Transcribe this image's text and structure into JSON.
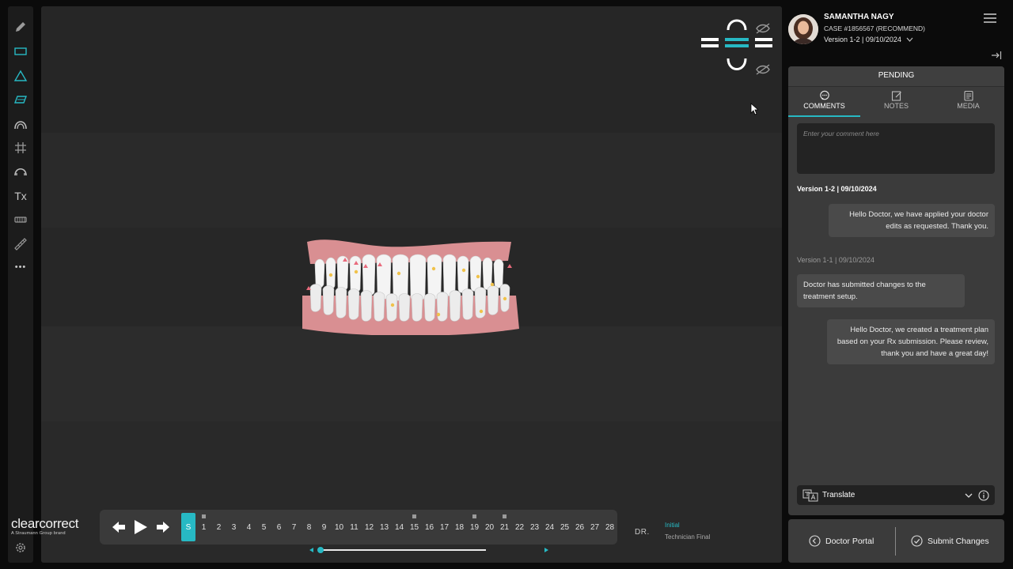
{
  "header": {
    "user_name": "SAMANTHA NAGY",
    "case_id": "CASE #1856567 (RECOMMEND)",
    "version_selected": "Version 1-2 | 09/10/2024"
  },
  "toolbar": {
    "tools": [
      "pencil-icon",
      "rectangle-icon",
      "triangle-icon",
      "parallelogram-icon",
      "arch-icon",
      "grid-icon",
      "upper-arch-icon",
      "tx-label",
      "teeth-icon",
      "ruler-icon",
      "more-icon"
    ],
    "tx_label": "Tx",
    "more_label": "•••"
  },
  "panel": {
    "status": "PENDING",
    "tabs": [
      {
        "label": "COMMENTS",
        "icon": "comment-icon",
        "active": true
      },
      {
        "label": "NOTES",
        "icon": "note-edit-icon",
        "active": false
      },
      {
        "label": "MEDIA",
        "icon": "media-icon",
        "active": false
      }
    ],
    "comment_placeholder": "Enter your comment here",
    "thread": [
      {
        "version": "Version 1-2 | 09/10/2024",
        "messages": [
          {
            "side": "right",
            "text": "Hello Doctor, we have applied your doctor edits as requested. Thank you."
          }
        ]
      },
      {
        "version": "Version 1-1 | 09/10/2024",
        "messages": [
          {
            "side": "left",
            "text": "Doctor has submitted changes to the treatment setup."
          },
          {
            "side": "right",
            "text": "Hello Doctor, we created a treatment plan based on your Rx submission. Please review, thank you and have a great day!"
          }
        ]
      }
    ],
    "translate_label": "Translate"
  },
  "actions": {
    "doctor_portal": "Doctor Portal",
    "submit_changes": "Submit Changes"
  },
  "viewer": {
    "logo_text": "clearcorrect",
    "logo_sub": "A Straumann Group brand",
    "stage_start_label": "S",
    "stages": [
      {
        "n": "1",
        "marked": true
      },
      {
        "n": "2",
        "marked": false
      },
      {
        "n": "3",
        "marked": false
      },
      {
        "n": "4",
        "marked": false
      },
      {
        "n": "5",
        "marked": false
      },
      {
        "n": "6",
        "marked": false
      },
      {
        "n": "7",
        "marked": false
      },
      {
        "n": "8",
        "marked": false
      },
      {
        "n": "9",
        "marked": false
      },
      {
        "n": "10",
        "marked": false
      },
      {
        "n": "11",
        "marked": false
      },
      {
        "n": "12",
        "marked": false
      },
      {
        "n": "13",
        "marked": false
      },
      {
        "n": "14",
        "marked": false
      },
      {
        "n": "15",
        "marked": true
      },
      {
        "n": "16",
        "marked": false
      },
      {
        "n": "17",
        "marked": false
      },
      {
        "n": "18",
        "marked": false
      },
      {
        "n": "19",
        "marked": true
      },
      {
        "n": "20",
        "marked": false
      },
      {
        "n": "21",
        "marked": true
      },
      {
        "n": "22",
        "marked": false
      },
      {
        "n": "23",
        "marked": false
      },
      {
        "n": "24",
        "marked": false
      },
      {
        "n": "25",
        "marked": false
      },
      {
        "n": "26",
        "marked": false
      },
      {
        "n": "27",
        "marked": false
      },
      {
        "n": "28",
        "marked": false
      }
    ],
    "dr_label": "DR.",
    "legend_initial": "Initial",
    "legend_final": "Technician Final",
    "accent_color": "#27b9c4",
    "gum_color": "#d98f92"
  }
}
